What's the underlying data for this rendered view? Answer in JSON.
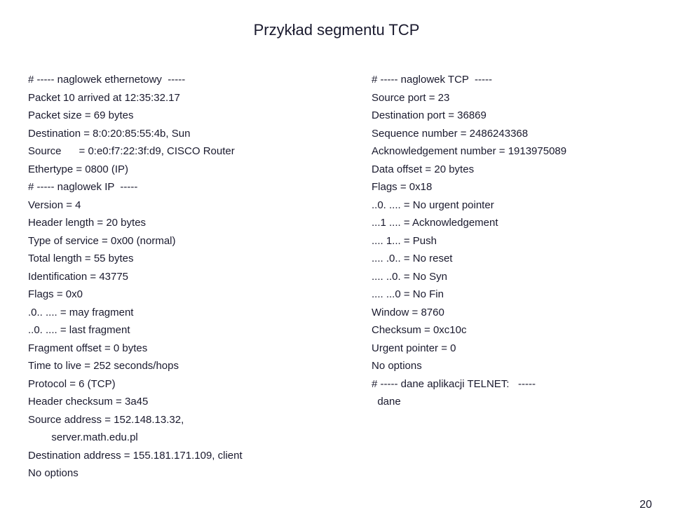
{
  "title": "Przykład segmentu TCP",
  "left_column": {
    "lines": [
      "# ----- naglowek ethernetowy  -----",
      "Packet 10 arrived at 12:35:32.17",
      "Packet size = 69 bytes",
      "Destination = 8:0:20:85:55:4b, Sun",
      "Source      = 0:e0:f7:22:3f:d9, CISCO Router",
      "Ethertype = 0800 (IP)",
      "# ----- naglowek IP  -----",
      "Version = 4",
      "Header length = 20 bytes",
      "Type of service = 0x00 (normal)",
      "Total length = 55 bytes",
      "Identification = 43775",
      "Flags = 0x0",
      ".0.. .... = may fragment",
      "..0. .... = last fragment",
      "Fragment offset = 0 bytes",
      "Time to live = 252 seconds/hops",
      "Protocol = 6 (TCP)",
      "Header checksum = 3a45",
      "Source address = 152.148.13.32,",
      "        server.math.edu.pl",
      "Destination address = 155.181.171.109, client",
      "No options"
    ]
  },
  "right_column": {
    "lines": [
      "# ----- naglowek TCP  -----",
      "Source port = 23",
      "Destination port = 36869",
      "Sequence number = 2486243368",
      "Acknowledgement number = 1913975089",
      "Data offset = 20 bytes",
      "Flags = 0x18",
      "..0. .... = No urgent pointer",
      "...1 .... = Acknowledgement",
      ".... 1... = Push",
      ".... .0.. = No reset",
      ".... ..0. = No Syn",
      ".... ...0 = No Fin",
      "Window = 8760",
      "Checksum = 0xc10c",
      "Urgent pointer = 0",
      "No options",
      "# ----- dane aplikacji TELNET:   -----",
      "  dane"
    ]
  },
  "page_number": "20"
}
